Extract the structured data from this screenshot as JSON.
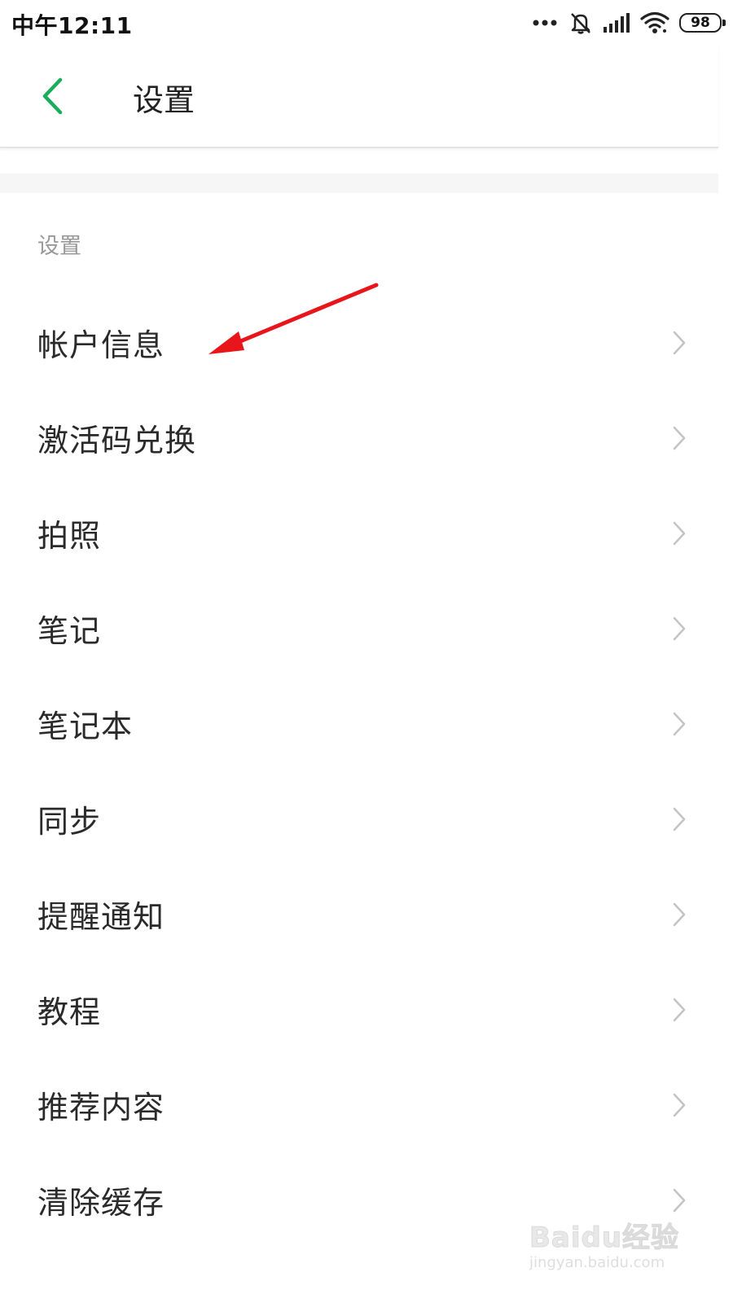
{
  "status_bar": {
    "time": "中午12:11",
    "battery": "98",
    "icons": [
      "more-dots-icon",
      "mute-bell-icon",
      "signal-icon",
      "wifi-icon",
      "battery-icon"
    ]
  },
  "header": {
    "title": "设置",
    "back_icon": "chevron-left-icon",
    "accent_color": "#1aad5b"
  },
  "section": {
    "label": "设置"
  },
  "settings_items": [
    {
      "label": "帐户信息"
    },
    {
      "label": "激活码兑换"
    },
    {
      "label": "拍照"
    },
    {
      "label": "笔记"
    },
    {
      "label": "笔记本"
    },
    {
      "label": "同步"
    },
    {
      "label": "提醒通知"
    },
    {
      "label": "教程"
    },
    {
      "label": "推荐内容"
    },
    {
      "label": "清除缓存"
    }
  ],
  "annotation": {
    "color": "#e8151b",
    "points_to": "帐户信息"
  },
  "watermark": {
    "main": "Baidu经验",
    "sub": "jingyan.baidu.com"
  }
}
